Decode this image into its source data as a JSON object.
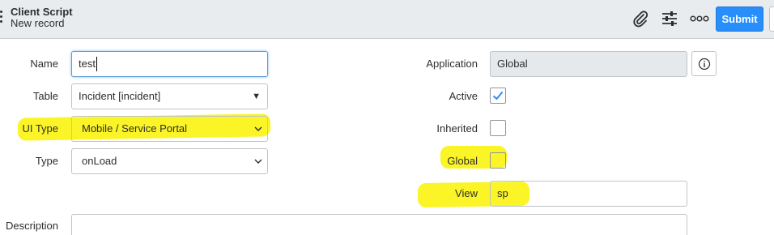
{
  "header": {
    "title": "Client Script",
    "subtitle": "New record",
    "submit_label": "Submit",
    "icons": [
      "menu-icon",
      "paperclip-icon",
      "sliders-icon",
      "more-icon"
    ]
  },
  "form": {
    "name": {
      "label": "Name",
      "value": "test"
    },
    "table": {
      "label": "Table",
      "value": "Incident [incident]"
    },
    "ui_type": {
      "label": "UI Type",
      "value": "Mobile / Service Portal"
    },
    "type": {
      "label": "Type",
      "value": "onLoad"
    },
    "description": {
      "label": "Description",
      "value": ""
    },
    "application": {
      "label": "Application",
      "value": "Global"
    },
    "active": {
      "label": "Active",
      "checked": true
    },
    "inherited": {
      "label": "Inherited",
      "checked": false
    },
    "global": {
      "label": "Global",
      "checked": false
    },
    "view": {
      "label": "View",
      "value": "sp"
    }
  },
  "colors": {
    "accent": "#278efc",
    "highlight": "#fbf313",
    "header_bg": "#e9ecef"
  }
}
